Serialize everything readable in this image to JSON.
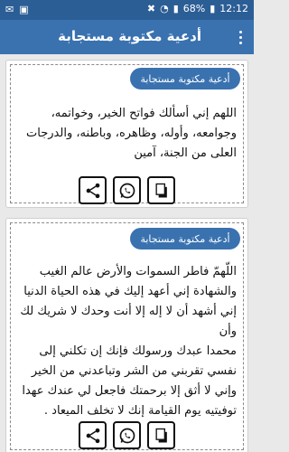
{
  "status": {
    "battery": "68%",
    "time": "12:12"
  },
  "appbar": {
    "title": "أدعية مكتوبة مستجابة"
  },
  "cards": [
    {
      "badge": "أدعية مكتوبة مستجابة",
      "text_lines": [
        "اللهم إني أسألك فواتح الخير، وخواتمه،",
        "وجوامعه، وأوله، وظاهره، وباطنه، والدرجات",
        "العلى من الجنة، آمين"
      ]
    },
    {
      "badge": "أدعية مكتوبة مستجابة",
      "text_lines": [
        "اللّهمّ فاطر السموات والأرض عالم الغيب",
        "والشهادة إني أعهد إليك في هذه الحياة الدنيا",
        "إني أشهد أن لا إله إلا أنت وحدك لا شريك لك وأن",
        "محمدا عبدك ورسولك فإنك إن تكلني إلى",
        "نفسي تقربني من الشر وتباعدني من الخير",
        "وإني لا أثق إلا برحمتك فاجعل لي عندك عهدا",
        "توفيتيه يوم القيامة إنك لا تخلف الميعاد ."
      ]
    }
  ],
  "icons": [
    "copy-icon",
    "whatsapp-icon",
    "share-icon"
  ]
}
